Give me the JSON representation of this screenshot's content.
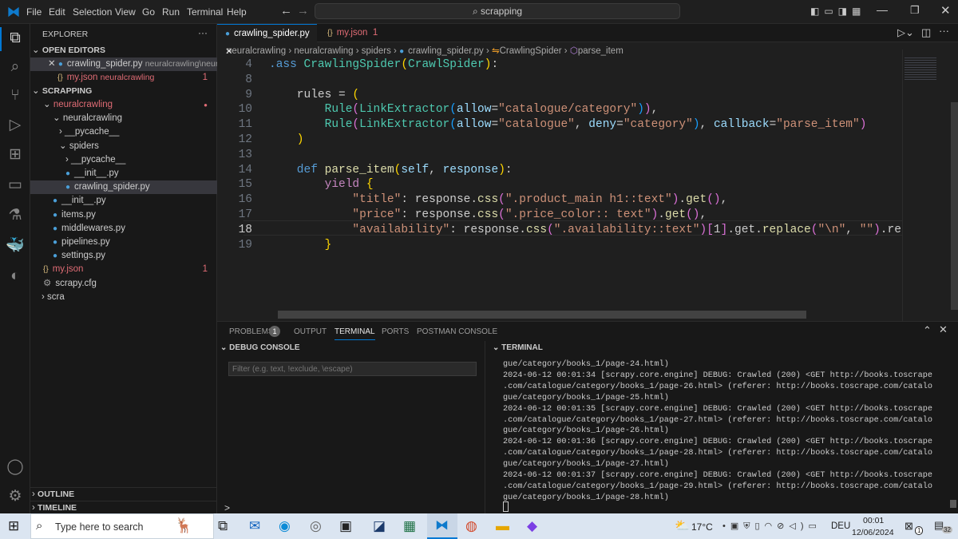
{
  "menu": [
    "File",
    "Edit",
    "Selection",
    "View",
    "Go",
    "Run",
    "Terminal",
    "Help"
  ],
  "search": "scrapping",
  "explorer": {
    "title": "EXPLORER",
    "more": "···",
    "open_editors": "OPEN EDITORS",
    "open": [
      {
        "name": "crawling_spider.py",
        "path": "neuralcrawling\\neural..."
      },
      {
        "name": "my.json",
        "path": "neuralcrawling",
        "badge": "1"
      }
    ],
    "workspace": "SCRAPPING",
    "tree": [
      "neuralcrawling",
      "neuralcrawling",
      "__pycache__",
      "spiders",
      "__pycache__",
      "__init__.py",
      "crawling_spider.py",
      "__init__.py",
      "items.py",
      "middlewares.py",
      "pipelines.py",
      "settings.py",
      "my.json",
      "scrapy.cfg",
      "scra"
    ],
    "my_json_badge": "1",
    "outline": "OUTLINE",
    "timeline": "TIMELINE"
  },
  "tabs": [
    {
      "label": "crawling_spider.py"
    },
    {
      "label": "my.json",
      "badge": "1"
    }
  ],
  "breadcrumb": [
    "neuralcrawling",
    "neuralcrawling",
    "spiders",
    "crawling_spider.py",
    "CrawlingSpider",
    "parse_item"
  ],
  "code": [
    {
      "n": "4",
      "t": [
        [
          ".ass ",
          "kw"
        ],
        [
          "CrawlingSpider",
          "cls"
        ],
        [
          "(",
          "br1"
        ],
        [
          "CrawlSpider",
          "cls"
        ],
        [
          ")",
          "br1"
        ],
        [
          ":",
          "pl"
        ]
      ]
    },
    {
      "n": "8",
      "t": []
    },
    {
      "n": "9",
      "t": [
        [
          "    rules = ",
          "pl"
        ],
        [
          "(",
          "br1"
        ]
      ]
    },
    {
      "n": "10",
      "t": [
        [
          "        Rule",
          "cls"
        ],
        [
          "(",
          "br2"
        ],
        [
          "LinkExtractor",
          "cls"
        ],
        [
          "(",
          "br3"
        ],
        [
          "allow",
          "par"
        ],
        [
          "=",
          "pl"
        ],
        [
          "\"catalogue/category\"",
          "str"
        ],
        [
          ")",
          "br3"
        ],
        [
          ")",
          "br2"
        ],
        [
          ",",
          "pl"
        ]
      ]
    },
    {
      "n": "11",
      "t": [
        [
          "        Rule",
          "cls"
        ],
        [
          "(",
          "br2"
        ],
        [
          "LinkExtractor",
          "cls"
        ],
        [
          "(",
          "br3"
        ],
        [
          "allow",
          "par"
        ],
        [
          "=",
          "pl"
        ],
        [
          "\"catalogue\"",
          "str"
        ],
        [
          ", ",
          "pl"
        ],
        [
          "deny",
          "par"
        ],
        [
          "=",
          "pl"
        ],
        [
          "\"category\"",
          "str"
        ],
        [
          ")",
          "br3"
        ],
        [
          ", ",
          "pl"
        ],
        [
          "callback",
          "par"
        ],
        [
          "=",
          "pl"
        ],
        [
          "\"parse_item\"",
          "str"
        ],
        [
          ")",
          "br2"
        ]
      ]
    },
    {
      "n": "12",
      "t": [
        [
          "    )",
          "br1"
        ]
      ]
    },
    {
      "n": "13",
      "t": []
    },
    {
      "n": "14",
      "t": [
        [
          "    def ",
          "kw"
        ],
        [
          "parse_item",
          "fn"
        ],
        [
          "(",
          "br1"
        ],
        [
          "self",
          "par"
        ],
        [
          ", ",
          "pl"
        ],
        [
          "response",
          "par"
        ],
        [
          ")",
          "br1"
        ],
        [
          ":",
          "pl"
        ]
      ]
    },
    {
      "n": "15",
      "t": [
        [
          "        yield ",
          "ctl"
        ],
        [
          "{",
          "br1"
        ]
      ]
    },
    {
      "n": "16",
      "t": [
        [
          "            \"title\"",
          "str"
        ],
        [
          ": response.",
          "pl"
        ],
        [
          "css",
          "fn"
        ],
        [
          "(",
          "br2"
        ],
        [
          "\".product_main h1::text\"",
          "str"
        ],
        [
          ")",
          "br2"
        ],
        [
          ".",
          "pl"
        ],
        [
          "get",
          "fn"
        ],
        [
          "()",
          "br2"
        ],
        [
          ",",
          "pl"
        ]
      ]
    },
    {
      "n": "17",
      "t": [
        [
          "            \"price\"",
          "str"
        ],
        [
          ": response.",
          "pl"
        ],
        [
          "css",
          "fn"
        ],
        [
          "(",
          "br2"
        ],
        [
          "\".price_color:: text\"",
          "str"
        ],
        [
          ")",
          "br2"
        ],
        [
          ".",
          "pl"
        ],
        [
          "get",
          "fn"
        ],
        [
          "()",
          "br2"
        ],
        [
          ",",
          "pl"
        ]
      ]
    },
    {
      "n": "18",
      "t": [
        [
          "            \"availability\"",
          "str"
        ],
        [
          ": response.",
          "pl"
        ],
        [
          "css",
          "fn"
        ],
        [
          "(",
          "br2"
        ],
        [
          "\".availability::text\"",
          "str"
        ],
        [
          ")",
          "br2"
        ],
        [
          "[",
          "br2"
        ],
        [
          "1",
          "pl"
        ],
        [
          "]",
          "br2"
        ],
        [
          ".get.",
          "pl"
        ],
        [
          "replace",
          "fn"
        ],
        [
          "(",
          "br2"
        ],
        [
          "\"\\n\"",
          "str"
        ],
        [
          ", ",
          "pl"
        ],
        [
          "\"\"",
          "str"
        ],
        [
          ")",
          "br2"
        ],
        [
          ".repl",
          "pl"
        ]
      ]
    },
    {
      "n": "19",
      "t": [
        [
          "        }",
          "br1"
        ]
      ]
    }
  ],
  "panel": {
    "tabs": [
      "PROBLEMS",
      "OUTPUT",
      "TERMINAL",
      "PORTS",
      "POSTMAN CONSOLE"
    ],
    "problems_count": "1",
    "debug_console": "DEBUG CONSOLE",
    "filter_placeholder": "Filter (e.g. text, !exclude, \\escape)",
    "terminal": "TERMINAL",
    "prompt": ">"
  },
  "terminal_lines": [
    "gue/category/books_1/page-24.html)",
    "2024-06-12 00:01:34 [scrapy.core.engine] DEBUG: Crawled (200) <GET http://books.toscrape",
    ".com/catalogue/category/books_1/page-26.html> (referer: http://books.toscrape.com/catalo",
    "gue/category/books_1/page-25.html)",
    "2024-06-12 00:01:35 [scrapy.core.engine] DEBUG: Crawled (200) <GET http://books.toscrape",
    ".com/catalogue/category/books_1/page-27.html> (referer: http://books.toscrape.com/catalo",
    "gue/category/books_1/page-26.html)",
    "2024-06-12 00:01:36 [scrapy.core.engine] DEBUG: Crawled (200) <GET http://books.toscrape",
    ".com/catalogue/category/books_1/page-28.html> (referer: http://books.toscrape.com/catalo",
    "gue/category/books_1/page-27.html)",
    "2024-06-12 00:01:37 [scrapy.core.engine] DEBUG: Crawled (200) <GET http://books.toscrape",
    ".com/catalogue/category/books_1/page-29.html> (referer: http://books.toscrape.com/catalo",
    "gue/category/books_1/page-28.html)"
  ],
  "taskbar": {
    "search_placeholder": "Type here to search",
    "weather": "17°C",
    "lang": "DEU",
    "time": "00:01",
    "date": "12/06/2024",
    "notif1": "1",
    "notif2": "32"
  }
}
